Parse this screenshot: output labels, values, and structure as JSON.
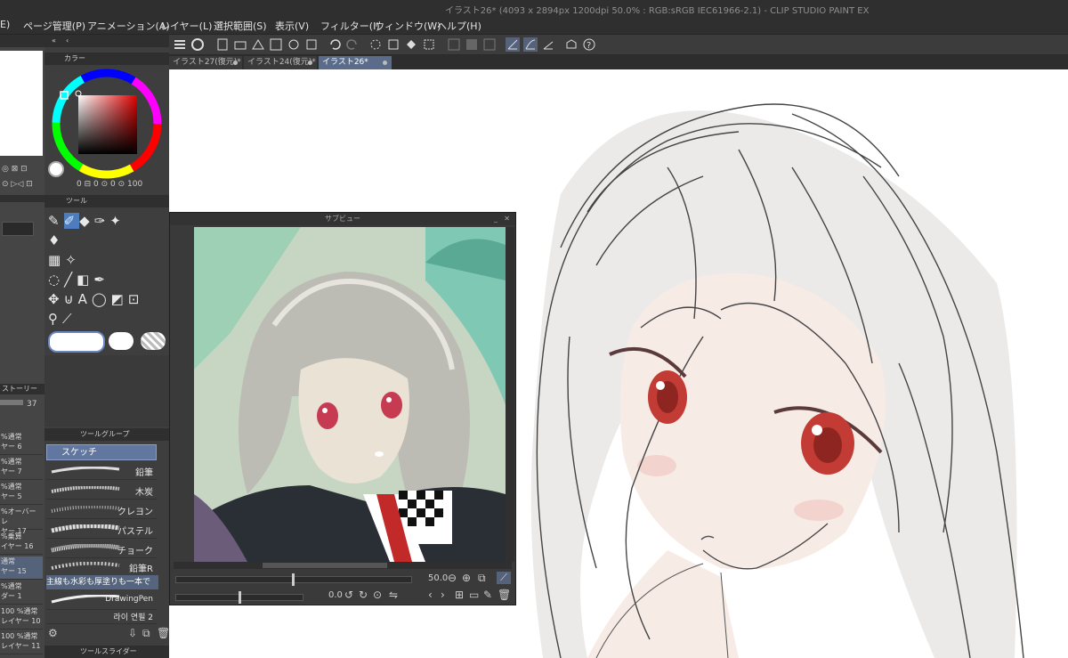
{
  "window_title": "イラスト26* (4093 x 2894px 1200dpi 50.0% : RGB:sRGB IEC61966-2.1) - CLIP STUDIO PAINT EX",
  "menu": [
    "E)",
    "ページ管理(P)",
    "アニメーション(A)",
    "レイヤー(L)",
    "選択範囲(S)",
    "表示(V)",
    "フィルター(I)",
    "ウィンドウ(W)",
    "ヘルプ(H)"
  ],
  "tabs": [
    {
      "label": "イラスト27(復元)*"
    },
    {
      "label": "イラスト24(復元)*"
    },
    {
      "label": "イラスト26*"
    }
  ],
  "color_panel": {
    "title": "カラー",
    "values": [
      "0",
      "0",
      "0",
      "100"
    ]
  },
  "tool_panel": {
    "title": "ツール"
  },
  "history": {
    "label": "ストーリー",
    "opacity": "37"
  },
  "tool_group": {
    "title": "ツールグループ"
  },
  "sub_tool": {
    "selected": "スケッチ"
  },
  "brushes": [
    "鉛筆",
    "木炭",
    "クレヨン",
    "パステル",
    "チョーク",
    "鉛筆R"
  ],
  "brush_hint": "主線も水彩も厚塗りも一本で",
  "brushes_extra": [
    "DrawingPen",
    "라이 연필 2"
  ],
  "slider_panel": {
    "title": "ツールスライダー"
  },
  "layers": [
    {
      "top": "%通常",
      "bottom": "ヤー 6"
    },
    {
      "top": "%通常",
      "bottom": "ヤー 7"
    },
    {
      "top": "%通常",
      "bottom": "ヤー 5"
    },
    {
      "top": "%オーバーレ",
      "bottom": "ヤー 17"
    },
    {
      "top": "%乗算",
      "bottom": "イヤー 16"
    },
    {
      "top": "通常",
      "bottom": "ヤー 15"
    },
    {
      "top": "%通常",
      "bottom": "ダー 1"
    },
    {
      "top": "100 %通常",
      "bottom": "レイヤー 10"
    },
    {
      "top": "100 %通常",
      "bottom": "レイヤー 11"
    }
  ],
  "subview": {
    "title": "サブビュー",
    "zoom": "50.0",
    "angle": "0.0"
  },
  "colors": {
    "accent": "#5a6c8a",
    "selected_layer": "#54627a",
    "panel_bg": "#3e3e3e",
    "menu_bg": "#2f2f2f",
    "canvas_bg": "#ffffff"
  }
}
